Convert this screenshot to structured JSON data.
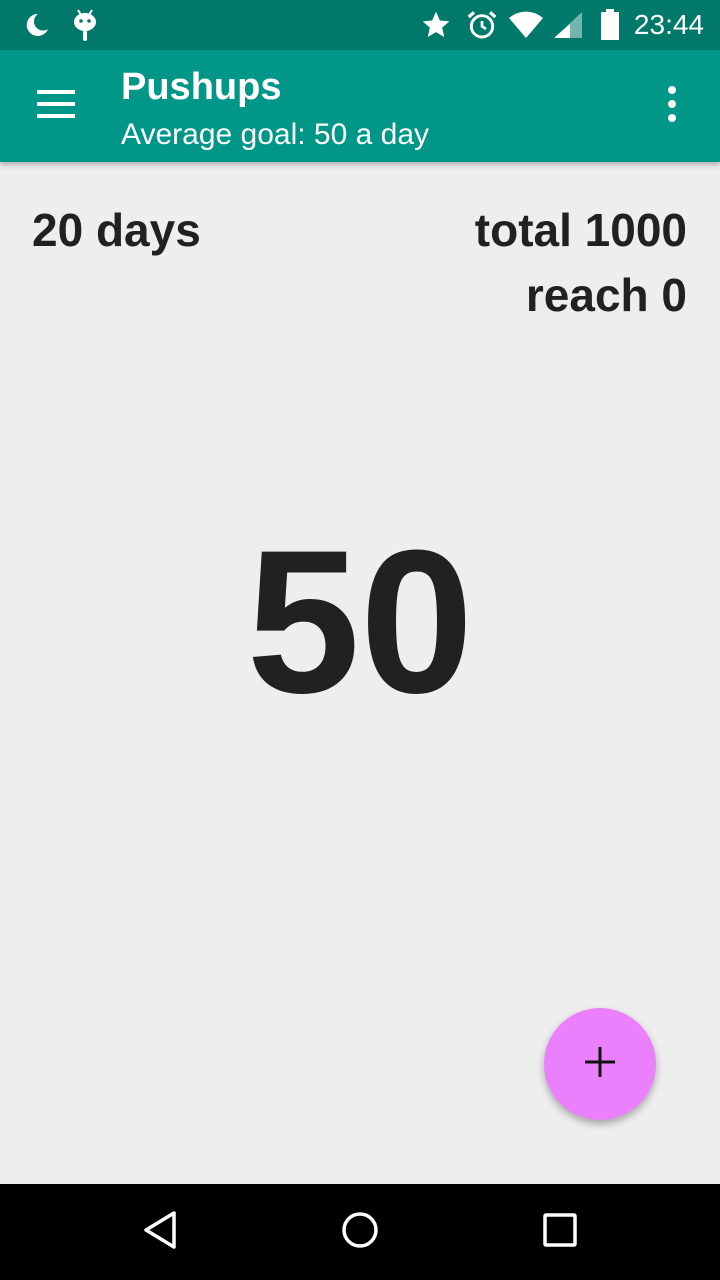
{
  "status_bar": {
    "time": "23:44",
    "icons": [
      "moon-icon",
      "android-debug-icon",
      "star-icon",
      "alarm-icon",
      "wifi-icon",
      "cell-signal-icon",
      "battery-icon"
    ]
  },
  "app_bar": {
    "title": "Pushups",
    "subtitle": "Average goal: 50 a day",
    "menu_icon": "menu-icon",
    "overflow_icon": "more-vert-icon"
  },
  "stats": {
    "days": "20 days",
    "total": "total 1000",
    "reach": "reach 0"
  },
  "main": {
    "count": "50"
  },
  "fab": {
    "icon": "add-icon",
    "color": "#ea80fc"
  },
  "nav_bar": {
    "icons": [
      "back-icon",
      "home-icon",
      "recents-icon"
    ]
  },
  "colors": {
    "status_bar": "#00796b",
    "app_bar": "#009688",
    "background": "#eeeeee",
    "text": "#212121"
  }
}
